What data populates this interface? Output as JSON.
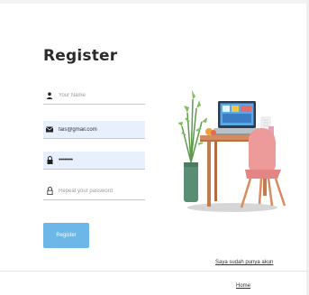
{
  "title": "Register",
  "fields": {
    "name": {
      "placeholder": "Your Name",
      "icon": "person-icon"
    },
    "email": {
      "value": "fais@gmail.com",
      "icon": "envelope-icon"
    },
    "password": {
      "value": "••••••••",
      "icon": "lock-icon"
    },
    "repeat": {
      "placeholder": "Repeat your password",
      "icon": "lock-icon"
    }
  },
  "button": {
    "label": "Register"
  },
  "links": {
    "login": "Saya sudah punya akun",
    "home": "Home"
  },
  "colors": {
    "button": "#6db6e8",
    "autofill": "#e8f0fe",
    "chair": "#ec9a9a",
    "desk": "#d28a5e"
  }
}
